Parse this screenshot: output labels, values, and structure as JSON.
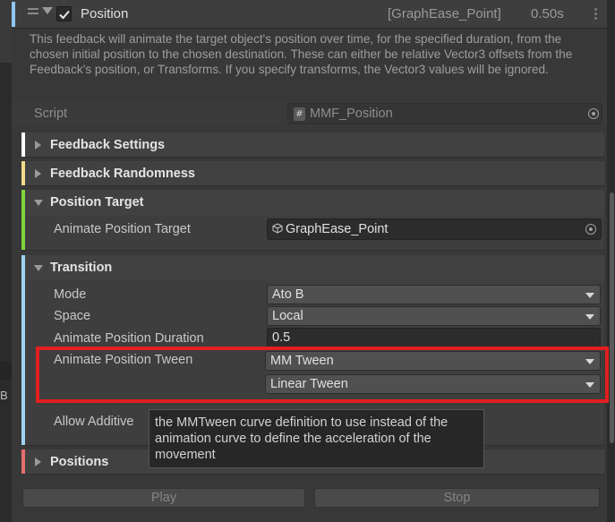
{
  "header": {
    "title": "Position",
    "target": "[GraphEase_Point]",
    "duration": "0.50s",
    "enabled": true,
    "accent_color": "#8fc8ef"
  },
  "description": "This feedback will animate the target object's position over time, for the specified duration, from the chosen initial position to the chosen destination. These can either be relative Vector3 offsets from the Feedback's position, or Transforms. If you specify transforms, the Vector3 values will be ignored.",
  "script": {
    "label": "Script",
    "value": "MMF_Position",
    "icon": "hash-script-icon"
  },
  "sections": {
    "feedback_settings": {
      "title": "Feedback Settings",
      "color": "#ffffff",
      "expanded": false
    },
    "feedback_randomness": {
      "title": "Feedback Randomness",
      "color": "#f2dc8a",
      "expanded": false
    },
    "position_target": {
      "title": "Position Target",
      "color": "#7fd63a",
      "expanded": true,
      "animate_position_target_label": "Animate Position Target",
      "animate_position_target_value": "GraphEase_Point"
    },
    "transition": {
      "title": "Transition",
      "color": "#9fd3ef",
      "expanded": true,
      "mode_label": "Mode",
      "mode_value": "Ato B",
      "space_label": "Space",
      "space_value": "Local",
      "duration_label": "Animate Position Duration",
      "duration_value": "0.5",
      "tween_label": "Animate Position Tween",
      "tween_value": "MM Tween",
      "tween_curve_value": "Linear Tween",
      "allow_additive_label": "Allow Additive"
    },
    "positions": {
      "title": "Positions",
      "color": "#e46f6f",
      "expanded": false
    }
  },
  "tooltip": {
    "text": "the MMTween curve definition to use instead of the animation curve to define the acceleration of the movement"
  },
  "buttons": {
    "play": "Play",
    "stop": "Stop"
  },
  "highlight_color": "#e11f1f",
  "left_edge_text": "B"
}
